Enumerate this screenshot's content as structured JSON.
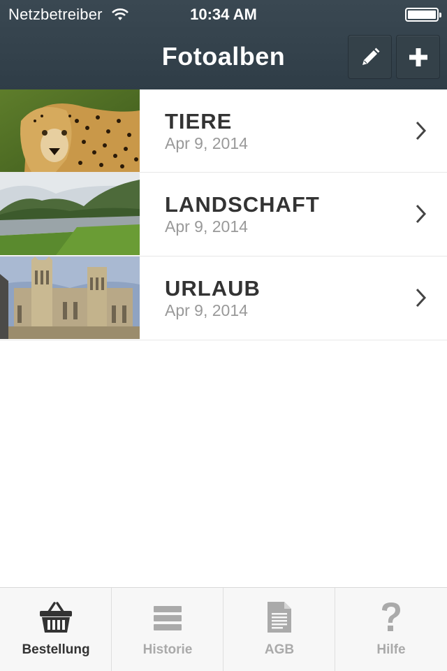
{
  "status_bar": {
    "carrier": "Netzbetreiber",
    "time": "10:34 AM",
    "wifi_icon": "wifi-icon",
    "battery_icon": "battery-icon"
  },
  "nav": {
    "title": "Fotoalben",
    "edit_icon": "pencil-icon",
    "add_icon": "plus-icon"
  },
  "albums": [
    {
      "name": "TIERE",
      "date": "Apr 9, 2014",
      "thumbnail": "cheetah-photo"
    },
    {
      "name": "LANDSCHAFT",
      "date": "Apr 9, 2014",
      "thumbnail": "river-landscape-photo"
    },
    {
      "name": "URLAUB",
      "date": "Apr 9, 2014",
      "thumbnail": "cathedral-photo"
    }
  ],
  "tabs": [
    {
      "label": "Bestellung",
      "icon": "basket-icon",
      "active": true
    },
    {
      "label": "Historie",
      "icon": "list-icon",
      "active": false
    },
    {
      "label": "AGB",
      "icon": "document-icon",
      "active": false
    },
    {
      "label": "Hilfe",
      "icon": "question-icon",
      "active": false
    }
  ],
  "colors": {
    "header": "#2f3d47",
    "active_tab": "#333333",
    "inactive_tab": "#aaaaaa"
  }
}
